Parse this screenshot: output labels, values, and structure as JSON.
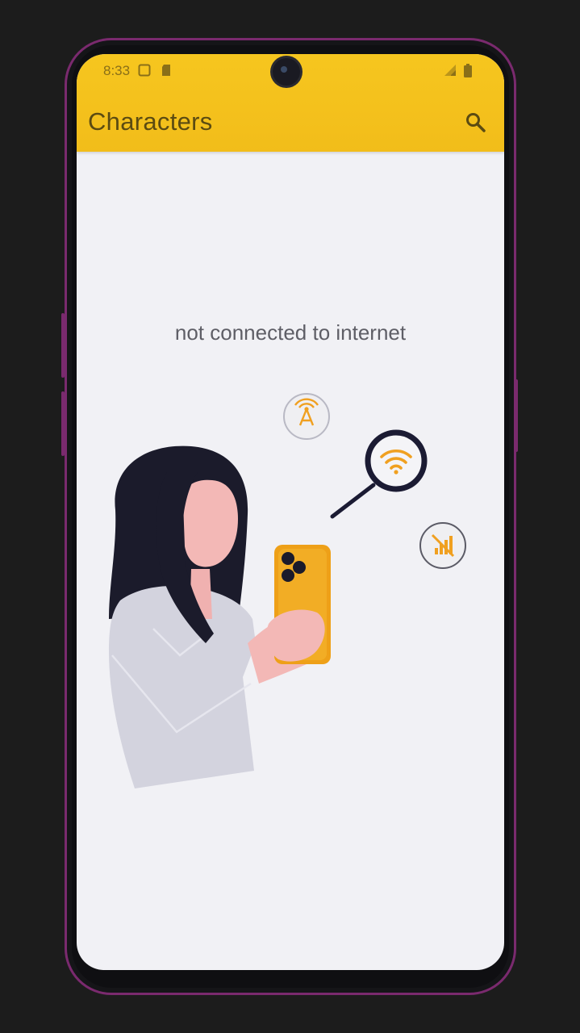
{
  "status_bar": {
    "time": "8:33"
  },
  "app_bar": {
    "title": "Characters",
    "search_icon": "search-icon"
  },
  "empty_state": {
    "message": "not connected to internet",
    "illustration_icons": [
      "cell-tower-icon",
      "wifi-icon",
      "no-signal-icon"
    ]
  },
  "colors": {
    "app_bar": "#f4c11c",
    "background": "#f1f1f5",
    "accent": "#f0a020",
    "frame": "#7a2a6e"
  }
}
